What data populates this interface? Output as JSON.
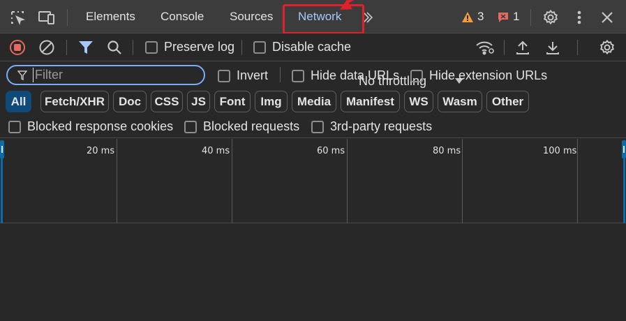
{
  "tabs": {
    "elements": "Elements",
    "console": "Console",
    "sources": "Sources",
    "network": "Network"
  },
  "status": {
    "warnings_count": "3",
    "errors_count": "1",
    "warning_color": "#f39c3b",
    "error_color": "#e46962"
  },
  "toolbar": {
    "preserve_log_label": "Preserve log",
    "disable_cache_label": "Disable cache",
    "throttling_value": "No throttling"
  },
  "filter": {
    "placeholder": "Filter",
    "invert_label": "Invert",
    "hide_data_urls_label": "Hide data URLs",
    "hide_extension_urls_label": "Hide extension URLs"
  },
  "type_filters": [
    "All",
    "Fetch/XHR",
    "Doc",
    "CSS",
    "JS",
    "Font",
    "Img",
    "Media",
    "Manifest",
    "WS",
    "Wasm",
    "Other"
  ],
  "blocking": {
    "blocked_cookies_label": "Blocked response cookies",
    "blocked_requests_label": "Blocked requests",
    "third_party_label": "3rd-party requests"
  },
  "timeline": {
    "ticks": [
      "20 ms",
      "40 ms",
      "60 ms",
      "80 ms",
      "100 ms"
    ]
  },
  "colors": {
    "accent": "#a8c7fa",
    "highlight": "#e0202a",
    "record_red": "#e46962",
    "chip_active": "#0f4a78"
  }
}
